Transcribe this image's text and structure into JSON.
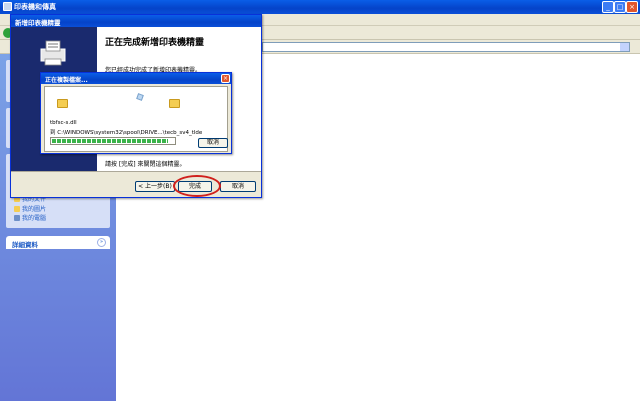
{
  "main_window": {
    "title": "印表機和傳真"
  },
  "sidebar": {
    "tasks": [
      {
        "label": "我的文件",
        "icon": "folder-icon"
      },
      {
        "label": "我的圖片",
        "icon": "pictures-icon"
      },
      {
        "label": "我的電腦",
        "icon": "computer-icon"
      }
    ],
    "details_label": "詳細資料"
  },
  "wizard": {
    "title": "新增印表機精靈",
    "heading": "正在完成新增印表機精靈",
    "desc": "您已經成功完成了新增印表機精靈。",
    "finish_note": "請按 [完成] 來關閉這個精靈。",
    "back_label": "< 上一步(B)",
    "finish_label": "完成",
    "cancel_label": "取消"
  },
  "copy_dialog": {
    "title": "正在複製檔案...",
    "file": "tbfsc-s.dll",
    "path": "到 C:\\WINDOWS\\system32\\spool\\DRIVE...\\tecb_sv4_tlde",
    "cancel_label": "取消",
    "progress": 0.95
  },
  "colors": {
    "titlebar": "#0543c9",
    "highlight_ring": "#d0201c"
  }
}
